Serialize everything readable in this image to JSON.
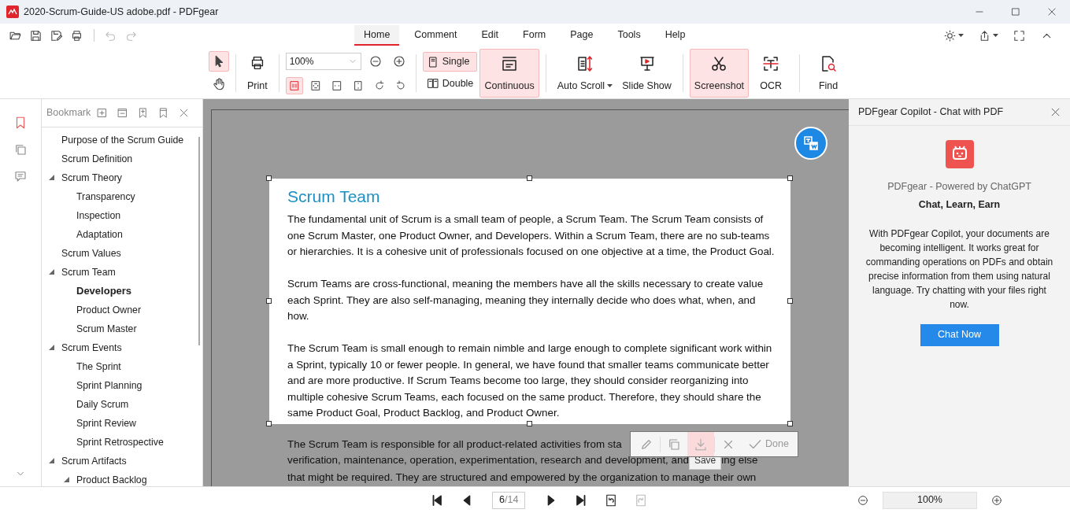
{
  "window": {
    "title": "2020-Scrum-Guide-US adobe.pdf - PDFgear"
  },
  "quick_access": [
    {
      "kind": "open",
      "disabled": false
    },
    {
      "kind": "save",
      "disabled": false
    },
    {
      "kind": "save_as",
      "disabled": false
    },
    {
      "kind": "print",
      "disabled": false
    },
    {
      "kind": "undo",
      "disabled": true
    },
    {
      "kind": "redo",
      "disabled": true
    }
  ],
  "menu_tabs": [
    {
      "label": "Home",
      "selected": true
    },
    {
      "label": "Comment",
      "selected": false
    },
    {
      "label": "Edit",
      "selected": false
    },
    {
      "label": "Form",
      "selected": false
    },
    {
      "label": "Page",
      "selected": false
    },
    {
      "label": "Tools",
      "selected": false
    },
    {
      "label": "Help",
      "selected": false
    }
  ],
  "header_actions": [
    {
      "kind": "theme",
      "dropdown": true
    },
    {
      "kind": "share",
      "dropdown": true
    },
    {
      "kind": "fullscreen",
      "dropdown": false
    },
    {
      "kind": "collapse",
      "dropdown": false
    }
  ],
  "ribbon": {
    "cursor_tools": [
      {
        "kind": "select",
        "selected": true
      },
      {
        "kind": "hand",
        "selected": false
      }
    ],
    "print": {
      "label": "Print"
    },
    "zoom": {
      "value": "100%"
    },
    "fit_tools": [
      {
        "kind": "actual_size",
        "selected": true
      },
      {
        "kind": "fit_page",
        "selected": false
      },
      {
        "kind": "fit_width",
        "selected": false
      },
      {
        "kind": "fit_height",
        "selected": false
      },
      {
        "kind": "rotate_right",
        "selected": false
      },
      {
        "kind": "rotate_left",
        "selected": false
      }
    ],
    "page_layout": [
      {
        "kind": "single",
        "label": "Single",
        "selected": true
      },
      {
        "kind": "double",
        "label": "Double",
        "selected": false
      }
    ],
    "tool_groups": [
      [
        {
          "kind": "continuous",
          "label": "Continuous",
          "selected": true,
          "dropdown": false
        }
      ],
      [
        {
          "kind": "auto_scroll",
          "label": "Auto Scroll",
          "selected": false,
          "dropdown": true
        },
        {
          "kind": "slide_show",
          "label": "Slide Show",
          "selected": false,
          "dropdown": false
        }
      ],
      [
        {
          "kind": "screenshot",
          "label": "Screenshot",
          "selected": true,
          "dropdown": false
        },
        {
          "kind": "ocr",
          "label": "OCR",
          "selected": false,
          "dropdown": false
        }
      ],
      [
        {
          "kind": "find",
          "label": "Find",
          "selected": false,
          "dropdown": false
        }
      ]
    ]
  },
  "side_rail": {
    "items": [
      {
        "kind": "bookmarks",
        "selected": true
      },
      {
        "kind": "pages",
        "selected": false
      },
      {
        "kind": "comments",
        "selected": false
      }
    ]
  },
  "bookmarks": {
    "title": "Bookmark",
    "actions": [
      {
        "kind": "expand_all"
      },
      {
        "kind": "collapse_all"
      },
      {
        "kind": "add_bookmark"
      },
      {
        "kind": "bookmark"
      },
      {
        "kind": "close"
      }
    ],
    "items": [
      {
        "label": "Purpose of the Scrum Guide",
        "selected": false
      },
      {
        "label": "Scrum Definition",
        "selected": false
      },
      {
        "label": "Scrum Theory",
        "selected": false,
        "expanded": true,
        "children": [
          {
            "label": "Transparency",
            "selected": false
          },
          {
            "label": "Inspection",
            "selected": false
          },
          {
            "label": "Adaptation",
            "selected": false
          }
        ]
      },
      {
        "label": "Scrum Values",
        "selected": false
      },
      {
        "label": "Scrum Team",
        "selected": false,
        "expanded": true,
        "children": [
          {
            "label": "Developers",
            "selected": true
          },
          {
            "label": "Product Owner",
            "selected": false
          },
          {
            "label": "Scrum Master",
            "selected": false
          }
        ]
      },
      {
        "label": "Scrum Events",
        "selected": false,
        "expanded": true,
        "children": [
          {
            "label": "The Sprint",
            "selected": false
          },
          {
            "label": "Sprint Planning",
            "selected": false
          },
          {
            "label": "Daily Scrum",
            "selected": false
          },
          {
            "label": "Sprint Review",
            "selected": false
          },
          {
            "label": "Sprint Retrospective",
            "selected": false
          }
        ]
      },
      {
        "label": "Scrum Artifacts",
        "selected": false,
        "expanded": true,
        "children": [
          {
            "label": "Product Backlog",
            "selected": false,
            "expanded": true
          }
        ]
      }
    ]
  },
  "document": {
    "selection": {
      "heading": "Scrum Team",
      "paragraphs": [
        "The fundamental unit of Scrum is a small team of people, a Scrum Team. The Scrum Team consists of one Scrum Master, one Product Owner, and Developers. Within a Scrum Team, there are no sub-teams or hierarchies. It is a cohesive unit of professionals focused on one objective at a time, the Product Goal.",
        "Scrum Teams are cross-functional, meaning the members have all the skills necessary to create value each Sprint. They are also self-managing, meaning they internally decide who does what, when, and how.",
        "The Scrum Team is small enough to remain nimble and large enough to complete significant work within a Sprint, typically 10 or fewer people. In general, we have found that smaller teams communicate better and are more productive. If Scrum Teams become too large, they should consider reorganizing into multiple cohesive Scrum Teams, each focused on the same product. Therefore, they should share the same Product Goal, Product Backlog, and Product Owner."
      ]
    },
    "dimmed_lines": [
      [
        "The Scrum Team is responsible for all product-related activities from sta"
      ],
      [
        "verification, maintenance, operation, experimentation, research and development, and",
        "ing else"
      ],
      [
        "that might be required. They are structured and empowered by the organization to manage their own"
      ]
    ],
    "selection_toolbar": [
      [
        {
          "kind": "edit",
          "hovered": false
        }
      ],
      [
        {
          "kind": "copy",
          "hovered": false
        },
        {
          "kind": "save",
          "hovered": true
        }
      ],
      [
        {
          "kind": "cancel",
          "hovered": false
        },
        {
          "kind": "done",
          "label": "Done",
          "hovered": false
        }
      ]
    ],
    "tooltip": "Save"
  },
  "copilot": {
    "title": "PDFgear Copilot - Chat with PDF",
    "subtitle": "PDFgear - Powered by ChatGPT",
    "tagline": "Chat, Learn, Earn",
    "description": "With PDFgear Copilot, your documents are becoming intelligent. It works great for commanding operations on PDFs and obtain precise information from them using natural language. Try chatting with your files right now.",
    "button": "Chat Now"
  },
  "pager": {
    "buttons_before": [
      {
        "kind": "first",
        "disabled": false
      },
      {
        "kind": "prev",
        "disabled": false
      }
    ],
    "page": "6",
    "total": "/14",
    "buttons_after": [
      {
        "kind": "next",
        "disabled": false
      },
      {
        "kind": "last",
        "disabled": false
      },
      {
        "kind": "view_back",
        "disabled": false
      },
      {
        "kind": "view_forward",
        "disabled": true
      }
    ]
  },
  "zoom_bar": {
    "value": "100%"
  }
}
